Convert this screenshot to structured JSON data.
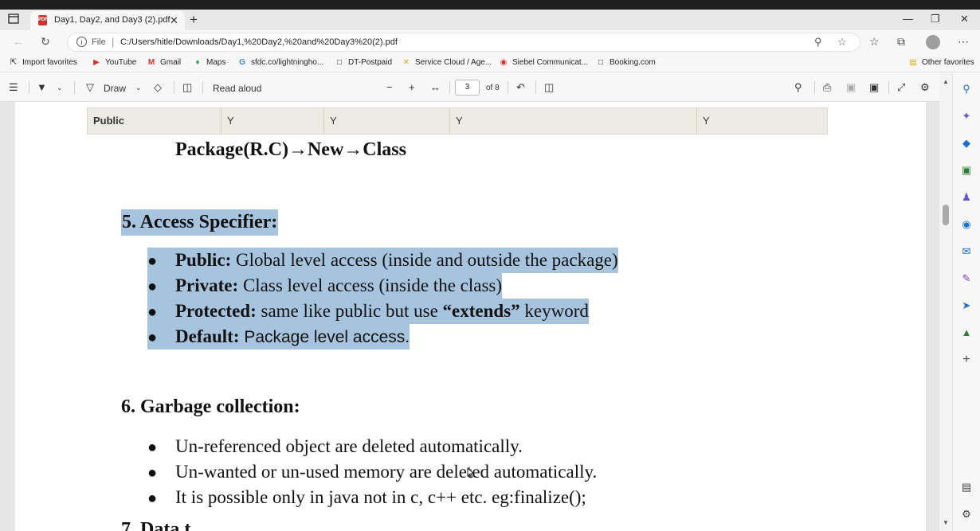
{
  "browser": {
    "tab_title": "Day1, Day2, and Day3 (2).pdf",
    "tab_close": "✕",
    "new_tab": "+",
    "address": {
      "file_label": "File",
      "url": "C:/Users/hitle/Downloads/Day1,%20Day2,%20and%20Day3%20(2).pdf"
    },
    "favorites": [
      {
        "label": "Import favorites",
        "icon": "import-icon"
      },
      {
        "label": "YouTube",
        "icon": "youtube-icon"
      },
      {
        "label": "Gmail",
        "icon": "gmail-icon"
      },
      {
        "label": "Maps",
        "icon": "maps-icon"
      },
      {
        "label": "sfdc.co/lightningho...",
        "icon": "google-icon"
      },
      {
        "label": "DT-Postpaid",
        "icon": "page-icon"
      },
      {
        "label": "Service Cloud / Age...",
        "icon": "service-cloud-icon"
      },
      {
        "label": "Siebel Communicat...",
        "icon": "siebel-icon"
      },
      {
        "label": "Booking.com",
        "icon": "page-icon"
      }
    ],
    "other_favorites": "Other favorites"
  },
  "pdf_toolbar": {
    "draw_label": "Draw",
    "read_aloud_label": "Read aloud",
    "page_current": "3",
    "page_total": "of 8"
  },
  "document": {
    "table_row": [
      "Public",
      "Y",
      "Y",
      "Y",
      "Y"
    ],
    "package_path": "Package(R.C)→New→Class",
    "section5": {
      "heading": "5. Access Specifier:",
      "items": [
        {
          "term": "Public:",
          "desc": " Global level access (inside and outside the package)"
        },
        {
          "term": "Private:",
          "desc": " Class level access (inside the class)"
        },
        {
          "term": "Protected:",
          "desc": " same like public but use ",
          "extra_bold": "“extends”",
          "tail": " keyword"
        },
        {
          "term": "Default:",
          "desc": " Package level access."
        }
      ]
    },
    "section6": {
      "heading": "6. Garbage collection:",
      "items": [
        "Un-referenced object are deleted automatically.",
        "Un-wanted or un-used memory are deleted automatically.",
        "It is possible only in java not in c, c++ etc. eg:finalize();"
      ]
    },
    "next_heading_partial": "7. Data t"
  },
  "colors": {
    "highlight": "#a7c4df",
    "table_bg": "#ecece4",
    "edge_accent": "#1a6fd6"
  }
}
